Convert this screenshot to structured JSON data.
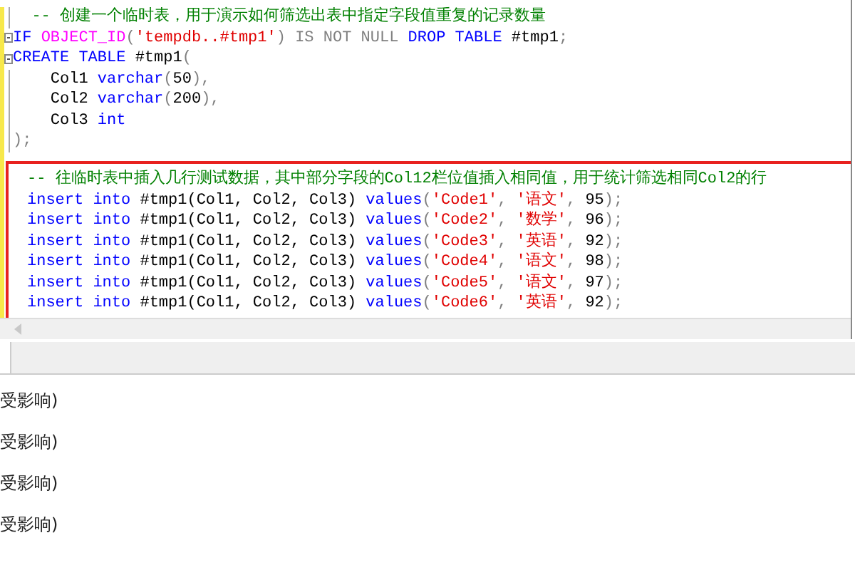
{
  "editor": {
    "lines": [
      {
        "fold": false,
        "tokens": [
          {
            "kind": "comment",
            "t": "  -- 创建一个临时表，用于演示如何筛选出表中指定字段值重复的记录数量"
          }
        ]
      },
      {
        "fold": true,
        "tokens": [
          {
            "kind": "keyword",
            "t": "IF "
          },
          {
            "kind": "function",
            "t": "OBJECT_ID"
          },
          {
            "kind": "operator",
            "t": "("
          },
          {
            "kind": "string",
            "t": "'tempdb..#tmp1'"
          },
          {
            "kind": "operator",
            "t": ") IS NOT NULL "
          },
          {
            "kind": "keyword",
            "t": "DROP TABLE "
          },
          {
            "kind": "plain",
            "t": "#tmp1"
          },
          {
            "kind": "operator",
            "t": ";"
          }
        ]
      },
      {
        "fold": true,
        "tokens": [
          {
            "kind": "keyword",
            "t": "CREATE TABLE "
          },
          {
            "kind": "plain",
            "t": "#tmp1"
          },
          {
            "kind": "operator",
            "t": "("
          }
        ]
      },
      {
        "fold": false,
        "tokens": [
          {
            "kind": "plain",
            "t": "    Col1 "
          },
          {
            "kind": "keyword",
            "t": "varchar"
          },
          {
            "kind": "operator",
            "t": "("
          },
          {
            "kind": "plain",
            "t": "50"
          },
          {
            "kind": "operator",
            "t": "),"
          }
        ]
      },
      {
        "fold": false,
        "tokens": [
          {
            "kind": "plain",
            "t": "    Col2 "
          },
          {
            "kind": "keyword",
            "t": "varchar"
          },
          {
            "kind": "operator",
            "t": "("
          },
          {
            "kind": "plain",
            "t": "200"
          },
          {
            "kind": "operator",
            "t": "),"
          }
        ]
      },
      {
        "fold": false,
        "tokens": [
          {
            "kind": "plain",
            "t": "    Col3 "
          },
          {
            "kind": "keyword",
            "t": "int"
          }
        ]
      },
      {
        "fold": false,
        "tokens": [
          {
            "kind": "operator",
            "t": ");"
          }
        ]
      }
    ],
    "highlighted_block": {
      "lines": [
        {
          "tokens": [
            {
              "kind": "comment",
              "t": "-- 往临时表中插入几行测试数据，其中部分字段的Col12栏位值插入相同值，用于统计筛选相同Col2的行"
            }
          ]
        },
        {
          "tokens": [
            {
              "kind": "keyword",
              "t": "insert into "
            },
            {
              "kind": "plain",
              "t": "#tmp1(Col1, Col2, Col3) "
            },
            {
              "kind": "keyword",
              "t": "values"
            },
            {
              "kind": "operator",
              "t": "("
            },
            {
              "kind": "string",
              "t": "'Code1'"
            },
            {
              "kind": "operator",
              "t": ", "
            },
            {
              "kind": "string",
              "t": "'语文'"
            },
            {
              "kind": "operator",
              "t": ", "
            },
            {
              "kind": "plain",
              "t": "95"
            },
            {
              "kind": "operator",
              "t": ");"
            }
          ]
        },
        {
          "tokens": [
            {
              "kind": "keyword",
              "t": "insert into "
            },
            {
              "kind": "plain",
              "t": "#tmp1(Col1, Col2, Col3) "
            },
            {
              "kind": "keyword",
              "t": "values"
            },
            {
              "kind": "operator",
              "t": "("
            },
            {
              "kind": "string",
              "t": "'Code2'"
            },
            {
              "kind": "operator",
              "t": ", "
            },
            {
              "kind": "string",
              "t": "'数学'"
            },
            {
              "kind": "operator",
              "t": ", "
            },
            {
              "kind": "plain",
              "t": "96"
            },
            {
              "kind": "operator",
              "t": ");"
            }
          ]
        },
        {
          "tokens": [
            {
              "kind": "keyword",
              "t": "insert into "
            },
            {
              "kind": "plain",
              "t": "#tmp1(Col1, Col2, Col3) "
            },
            {
              "kind": "keyword",
              "t": "values"
            },
            {
              "kind": "operator",
              "t": "("
            },
            {
              "kind": "string",
              "t": "'Code3'"
            },
            {
              "kind": "operator",
              "t": ", "
            },
            {
              "kind": "string",
              "t": "'英语'"
            },
            {
              "kind": "operator",
              "t": ", "
            },
            {
              "kind": "plain",
              "t": "92"
            },
            {
              "kind": "operator",
              "t": ");"
            }
          ]
        },
        {
          "tokens": [
            {
              "kind": "keyword",
              "t": "insert into "
            },
            {
              "kind": "plain",
              "t": "#tmp1(Col1, Col2, Col3) "
            },
            {
              "kind": "keyword",
              "t": "values"
            },
            {
              "kind": "operator",
              "t": "("
            },
            {
              "kind": "string",
              "t": "'Code4'"
            },
            {
              "kind": "operator",
              "t": ", "
            },
            {
              "kind": "string",
              "t": "'语文'"
            },
            {
              "kind": "operator",
              "t": ", "
            },
            {
              "kind": "plain",
              "t": "98"
            },
            {
              "kind": "operator",
              "t": ");"
            }
          ]
        },
        {
          "tokens": [
            {
              "kind": "keyword",
              "t": "insert into "
            },
            {
              "kind": "plain",
              "t": "#tmp1(Col1, Col2, Col3) "
            },
            {
              "kind": "keyword",
              "t": "values"
            },
            {
              "kind": "operator",
              "t": "("
            },
            {
              "kind": "string",
              "t": "'Code5'"
            },
            {
              "kind": "operator",
              "t": ", "
            },
            {
              "kind": "string",
              "t": "'语文'"
            },
            {
              "kind": "operator",
              "t": ", "
            },
            {
              "kind": "plain",
              "t": "97"
            },
            {
              "kind": "operator",
              "t": ");"
            }
          ]
        },
        {
          "tokens": [
            {
              "kind": "keyword",
              "t": "insert into "
            },
            {
              "kind": "plain",
              "t": "#tmp1(Col1, Col2, Col3) "
            },
            {
              "kind": "keyword",
              "t": "values"
            },
            {
              "kind": "operator",
              "t": "("
            },
            {
              "kind": "string",
              "t": "'Code6'"
            },
            {
              "kind": "operator",
              "t": ", "
            },
            {
              "kind": "string",
              "t": "'英语'"
            },
            {
              "kind": "operator",
              "t": ", "
            },
            {
              "kind": "plain",
              "t": "92"
            },
            {
              "kind": "operator",
              "t": ");"
            }
          ]
        }
      ]
    }
  },
  "messages": [
    "受影响)",
    "受影响)",
    "受影响)",
    "受影响)"
  ]
}
